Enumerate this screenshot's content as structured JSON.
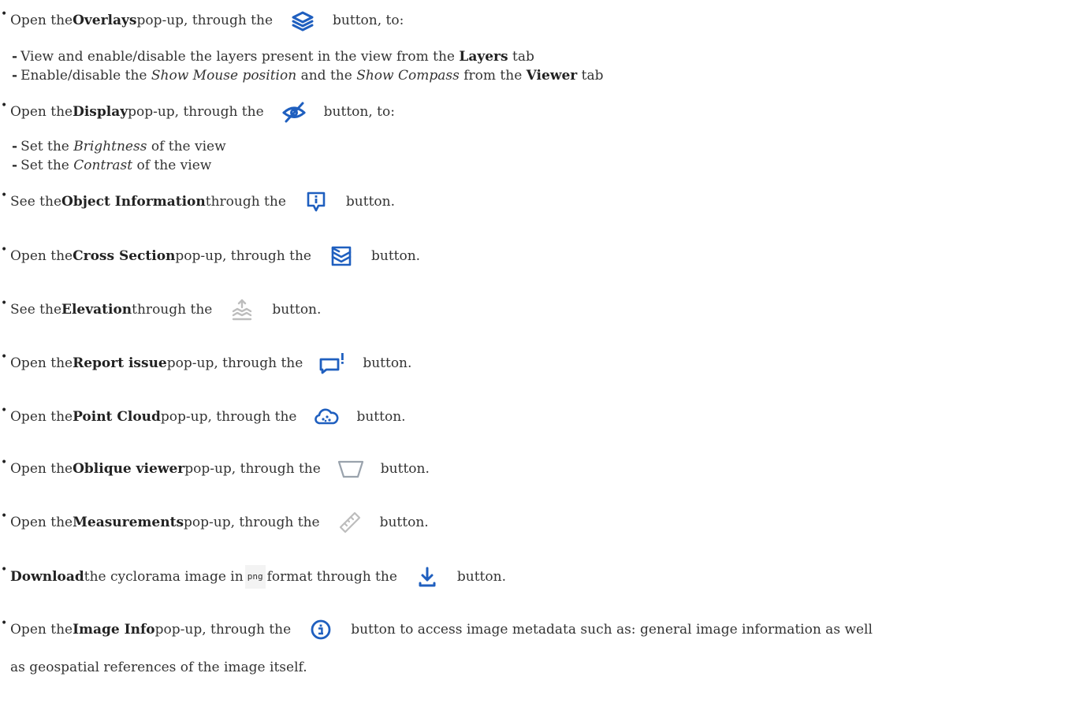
{
  "items": [
    {
      "pre": "Open the ",
      "bold": "Overlays",
      "mid": " pop-up, through the ",
      "icon": "layers-icon",
      "post": " button, to:",
      "subs": [
        {
          "dash": "-",
          "parts": [
            "View and enable/disable the layers present in the view from the ",
            "Layers",
            " tab"
          ]
        },
        {
          "dash": "-",
          "parts": [
            "Enable/disable the ",
            "Show Mouse position",
            " and the ",
            "Show Compass",
            " from the ",
            "Viewer",
            " tab"
          ]
        }
      ]
    },
    {
      "pre": "Open the ",
      "bold": "Display",
      "mid": " pop-up, through the ",
      "icon": "eye-off-icon",
      "post": " button, to:",
      "subs": [
        {
          "dash": "-",
          "parts": [
            "Set the ",
            "Brightness",
            " of the view"
          ]
        },
        {
          "dash": "-",
          "parts": [
            "Set the ",
            "Contrast",
            " of the view"
          ]
        }
      ]
    },
    {
      "pre": "See the ",
      "bold": "Object Information",
      "mid": " through the ",
      "icon": "info-pin-icon",
      "post": " button."
    },
    {
      "pre": "Open the ",
      "bold": "Cross Section",
      "mid": " pop-up, through the ",
      "icon": "cross-section-icon",
      "post": " button."
    },
    {
      "pre": "See the ",
      "bold": "Elevation",
      "mid": " through the ",
      "icon": "elevation-icon",
      "post": " button."
    },
    {
      "pre": "Open the ",
      "bold": "Report issue",
      "mid": " pop-up, through the ",
      "icon": "report-issue-icon",
      "post": " button."
    },
    {
      "pre": "Open the ",
      "bold": "Point Cloud",
      "mid": " pop-up, through the ",
      "icon": "point-cloud-icon",
      "post": " button."
    },
    {
      "pre": "Open the ",
      "bold": "Oblique viewer",
      "mid": " pop-up, through the ",
      "icon": "oblique-viewer-icon",
      "post": " button."
    },
    {
      "pre": "Open the ",
      "bold": "Measurements",
      "mid": " pop-up, through the ",
      "icon": "ruler-icon",
      "post": " button."
    },
    {
      "pre": "",
      "bold": "Download",
      "mid": " the cyclorama image in ",
      "code": "png",
      "mid2": " format through the ",
      "icon": "download-icon",
      "post": " button."
    },
    {
      "pre": "Open the ",
      "bold": "Image Info",
      "mid": " pop-up, through the ",
      "icon": "image-info-icon",
      "post": " button to access image metadata such as: general image information as well",
      "line2": "as geospatial references of the image itself."
    }
  ],
  "colors": {
    "icon_blue": "#1f5fbf",
    "icon_grey": "#bfbfbf",
    "text": "#333333"
  }
}
